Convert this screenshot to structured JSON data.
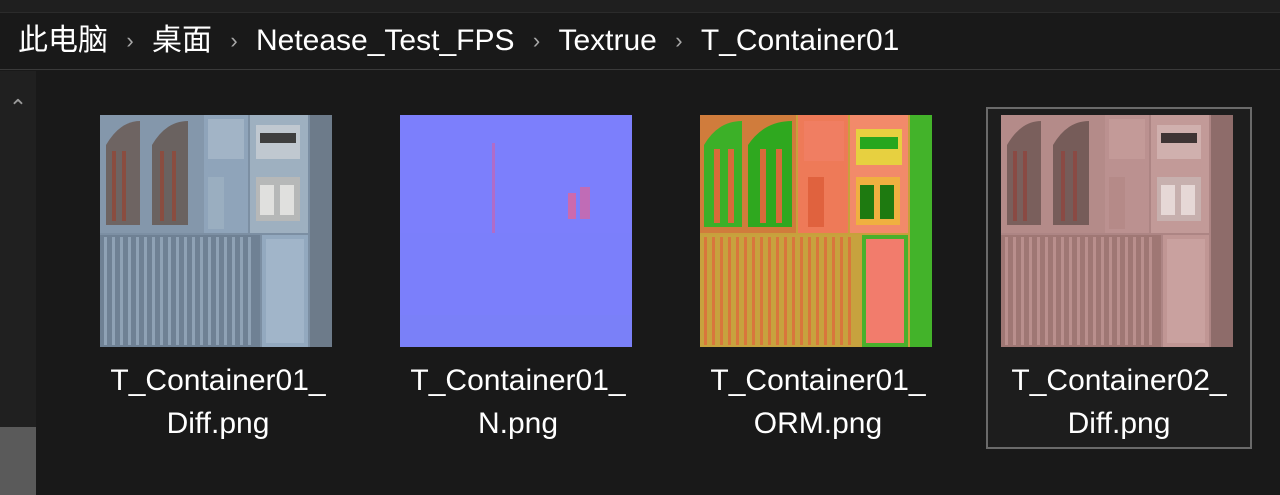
{
  "breadcrumb": {
    "items": [
      "此电脑",
      "桌面",
      "Netease_Test_FPS",
      "Textrue",
      "T_Container01"
    ],
    "separator_icon": "chevron-right-icon"
  },
  "sidebar": {
    "scroll_up_icon": "chevron-up-icon"
  },
  "files": [
    {
      "line1": "T_Container01_",
      "line2": "Diff.png",
      "thumb": "diffuse-blue-gray",
      "selected": false
    },
    {
      "line1": "T_Container01_",
      "line2": "N.png",
      "thumb": "normal-map-purple",
      "selected": false
    },
    {
      "line1": "T_Container01_",
      "line2": "ORM.png",
      "thumb": "orm-green-orange",
      "selected": false
    },
    {
      "line1": "T_Container02_",
      "line2": "Diff.png",
      "thumb": "diffuse-pink",
      "selected": true
    }
  ],
  "colors": {
    "background": "#191919",
    "diff01": "#7f93a8",
    "normal": "#7f7fff",
    "orm_green": "#3cb028",
    "orm_orange": "#e07848",
    "diff02": "#b88a88"
  }
}
